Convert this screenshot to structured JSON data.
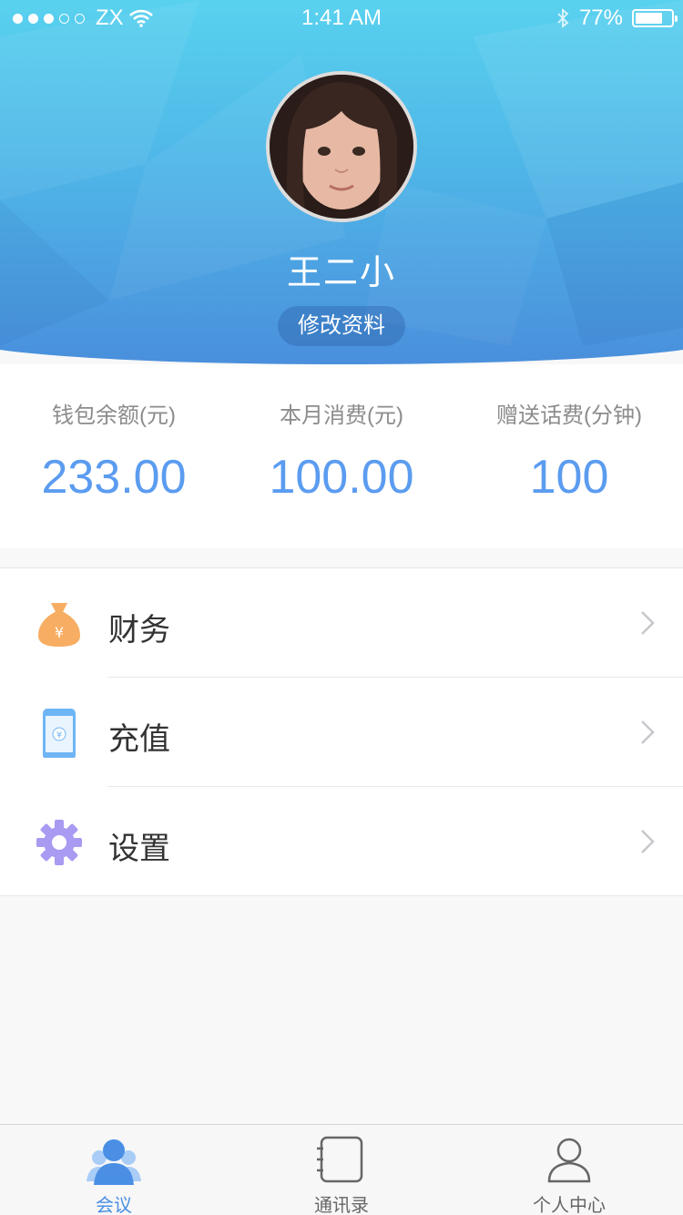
{
  "status_bar": {
    "carrier": "ZX",
    "time": "1:41 AM",
    "battery": "77%",
    "battery_level": 0.77
  },
  "profile": {
    "name": "王二小",
    "edit_label": "修改资料"
  },
  "stats": [
    {
      "label": "钱包余额(元)",
      "value": "233.00"
    },
    {
      "label": "本月消费(元)",
      "value": "100.00"
    },
    {
      "label": "赠送话费(分钟)",
      "value": "100"
    }
  ],
  "menu": [
    {
      "label": "财务",
      "icon": "money-bag-icon"
    },
    {
      "label": "充值",
      "icon": "phone-recharge-icon"
    },
    {
      "label": "设置",
      "icon": "gear-icon"
    }
  ],
  "tabbar": {
    "active": 0,
    "items": [
      {
        "label": "会议",
        "icon": "meeting-users-icon"
      },
      {
        "label": "通讯录",
        "icon": "contacts-book-icon"
      },
      {
        "label": "个人中心",
        "icon": "person-icon"
      }
    ]
  },
  "colors": {
    "accent": "#5b9cf0",
    "header_top": "#59d3ef",
    "header_bottom": "#4a8fdc",
    "money_icon": "#f7ad62",
    "recharge_icon": "#6eb5f5",
    "gear_icon": "#a99af2"
  }
}
